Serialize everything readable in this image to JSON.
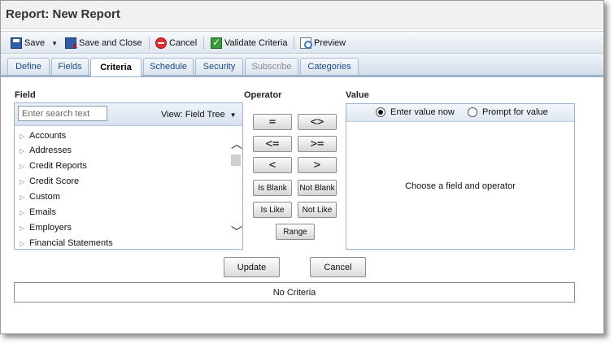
{
  "window": {
    "title": "Report: New Report"
  },
  "toolbar": {
    "save_label": "Save",
    "save_close_label": "Save and Close",
    "cancel_label": "Cancel",
    "validate_label": "Validate Criteria",
    "preview_label": "Preview",
    "icons": [
      "save-icon",
      "save-close-icon",
      "cancel-icon",
      "validate-icon",
      "preview-icon"
    ]
  },
  "tabs": [
    {
      "label": "Define",
      "state": "normal"
    },
    {
      "label": "Fields",
      "state": "normal"
    },
    {
      "label": "Criteria",
      "state": "active"
    },
    {
      "label": "Schedule",
      "state": "normal"
    },
    {
      "label": "Security",
      "state": "normal"
    },
    {
      "label": "Subscribe",
      "state": "disabled"
    },
    {
      "label": "Categories",
      "state": "normal"
    }
  ],
  "field": {
    "heading": "Field",
    "search_placeholder": "Enter search text",
    "view_label": "View: Field Tree",
    "items": [
      "Accounts",
      "Addresses",
      "Credit Reports",
      "Credit Score",
      "Custom",
      "Emails",
      "Employers",
      "Financial Statements"
    ]
  },
  "operator": {
    "heading": "Operator",
    "buttons": [
      "=",
      "<>",
      "<=",
      ">=",
      "<",
      ">",
      "Is Blank",
      "Not Blank",
      "Is Like",
      "Not Like",
      "Range"
    ]
  },
  "value": {
    "heading": "Value",
    "option_now": "Enter value now",
    "option_prompt": "Prompt for value",
    "selected": "Enter value now",
    "message": "Choose a field and operator"
  },
  "actions": {
    "update_label": "Update",
    "cancel_label": "Cancel"
  },
  "criteria": {
    "summary": "No Criteria"
  },
  "colors": {
    "accent": "#1a4c8c",
    "tab_border": "#9db2cc",
    "toolbar_bg": "#dfe6ef"
  }
}
